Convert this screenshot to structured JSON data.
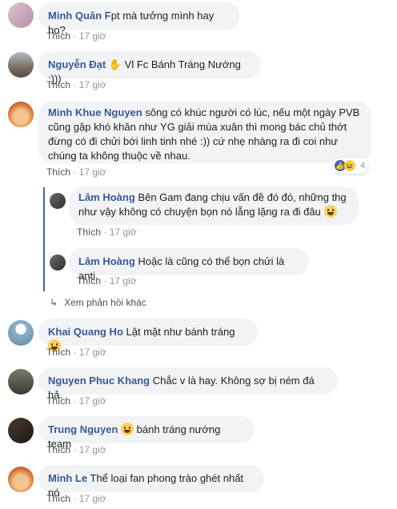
{
  "comments": [
    {
      "author": "Minh Quân",
      "text": "Fpt mà tưởng mình hay ho?",
      "like": "Thích",
      "time": "17 giờ"
    },
    {
      "author": "Nguyễn Đạt",
      "text": "Vl Fc Bánh Tráng Nướng :)))",
      "like": "Thích",
      "time": "17 giờ"
    },
    {
      "author": "Minh Khue Nguyen",
      "text": "sông có khúc người có lúc, nếu một ngày PVB cũng gặp khó khăn như YG giải mùa xuân thì mong bác chủ thớt đừng có đi chửi bới linh tinh nhé :)) cứ nhẹ nhàng ra đi coi như chúng ta không thuộc về nhau.",
      "like": "Thích",
      "time": "17 giờ",
      "reaction_count": "4"
    },
    {
      "author": "Khai Quang Ho",
      "text": "Lật mặt như bánh tráng",
      "like": "Thích",
      "time": "17 giờ"
    },
    {
      "author": "Nguyen Phuc Khang",
      "text": "Chắc v là hay. Không sợ bị ném đá hả.",
      "like": "Thích",
      "time": "17 giờ"
    },
    {
      "author": "Trung Nguyen",
      "text": "bánh tráng nướng team",
      "like": "Thích",
      "time": "17 giờ"
    },
    {
      "author": "Minh Le",
      "text": "Thể loại fan phong trào ghét nhất nó",
      "like": "Thích",
      "time": "17 giờ"
    }
  ],
  "replies": [
    {
      "author": "Lâm Hoàng",
      "text": "Bên Gam đang chịu vấn đề đó đó, những thg như vậy không có chuyện bọn nó lẵng lặng ra đi đâu",
      "like": "Thích",
      "time": "17 giờ"
    },
    {
      "author": "Lâm Hoàng",
      "text": "Hoặc là cũng có thể bọn chửi là anti",
      "like": "Thích",
      "time": "17 giờ"
    }
  ],
  "more_replies": "Xem phản hồi khác",
  "colors": {
    "link": "#385898",
    "bubble": "#f2f3f5",
    "thread": "#4267b2"
  }
}
